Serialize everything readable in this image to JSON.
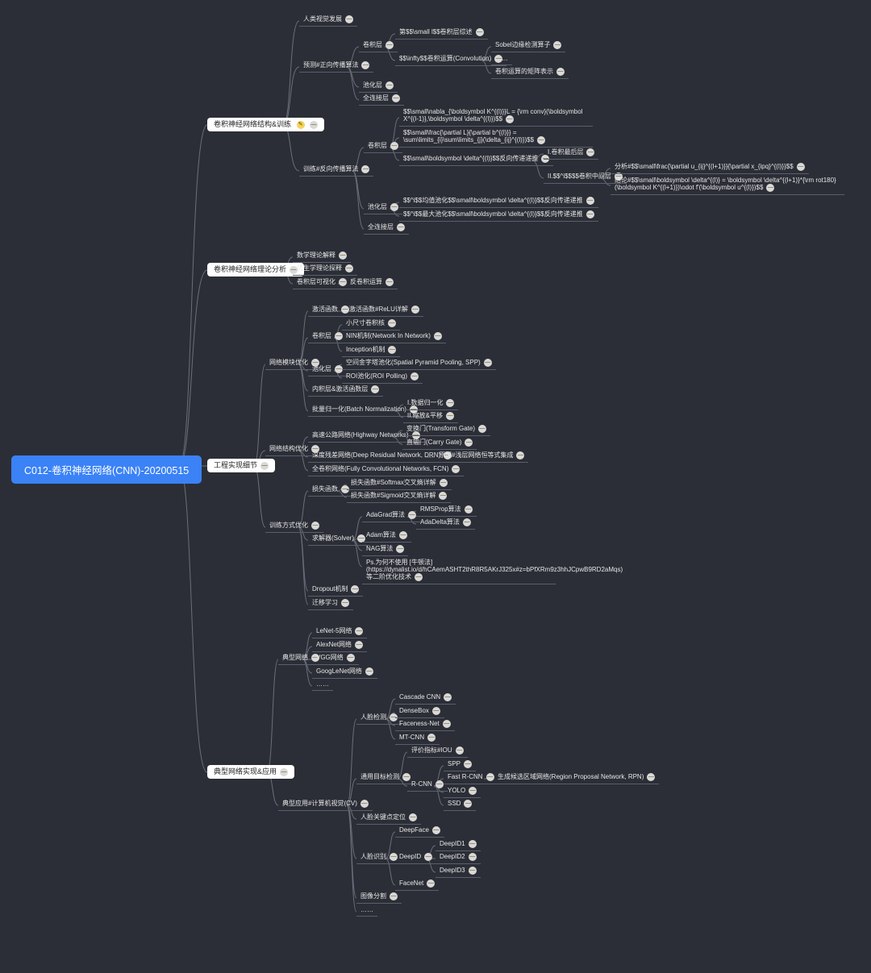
{
  "root": "C012-卷积神经网络(CNN)-20200515",
  "b1": "卷积神经网络结构&训练",
  "b1_a": "人类视觉发展",
  "b1_b": "预测#正向传播算法",
  "b1_b1": "卷积层",
  "b1_b1a": "第$$\\small l$$卷积层综述",
  "b1_b1b": "$$\\infty$$卷积运算(Convolution)",
  "b1_b1b1": "Sobel边缘检测算子",
  "b1_b1b2": "……",
  "b1_b1b3": "卷积运算的矩阵表示",
  "b1_b2": "池化层",
  "b1_b3": "全连接层",
  "b1_c": "训练#反向传播算法",
  "b1_c1": "卷积层",
  "b1_c1a": "$$\\small\\nabla_{\\boldsymbol K^{(l)}}L = {\\rm conv}(\\boldsymbol X^{(l-1)},\\boldsymbol \\delta^{(l)})$$",
  "b1_c1b": "$$\\small\\frac{\\partial L}{\\partial b^{(l)}} = \\sum\\limits_{i}\\sum\\limits_{j}(\\delta_{ij}^{(l)})$$",
  "b1_c1c": "$$\\small\\boldsymbol \\delta^{(l)}$$反向传递递推",
  "b1_c1c1": "I.卷积最后层",
  "b1_c1c2": "II.$$^i$$$$卷积中间层",
  "b1_c1c2a": "分析#$$\\small\\frac{\\partial u_{ij}^{(l+1)}}{\\partial x_{ipq}^{(l)}}$$",
  "b1_c1c2b": "结论#$$\\small\\boldsymbol \\delta^{(l)} = \\boldsymbol \\delta^{(l+1)}*{\\rm rot180}(\\boldsymbol K^{(l+1)})\\odot f'(\\boldsymbol u^{(l)})$$",
  "b1_c2": "池化层",
  "b1_c2a": "$$^i$$均值池化$$\\small\\boldsymbol \\delta^{(l)}$$反向传递递推",
  "b1_c2b": "$$^i$$最大池化$$\\small\\boldsymbol \\delta^{(l)}$$反向传递递推",
  "b1_c3": "全连接层",
  "b2": "卷积神经网络理论分析",
  "b2_a": "数学理论解释",
  "b2_b": "仿生学理论探释",
  "b2_c": "卷积层可视化",
  "b2_c1": "反卷积运算",
  "b3": "工程实现细节",
  "b3_a": "网络模块优化",
  "b3_a1": "激活函数",
  "b3_a1a": "激活函数#ReLU详解",
  "b3_a2": "卷积层",
  "b3_a2a": "小尺寸卷积核",
  "b3_a2b": "NIN机制(Network In Network)",
  "b3_a2c": "Inception机制",
  "b3_a3": "池化层",
  "b3_a3a": "空间金字塔池化(Spatial Pyramid Pooling, SPP)",
  "b3_a3b": "ROI池化(ROI Polling)",
  "b3_a4": "内积层&激活函数层",
  "b3_a5": "批量归一化(Batch Normalization)",
  "b3_a5a": "I.数据归一化",
  "b3_a5b": "II.缩放&平移",
  "b3_b": "网络结构优化",
  "b3_b1": "高速公路网络(Highway Networks)",
  "b3_b1a": "变换门(Transform Gate)",
  "b3_b1b": "直输门(Carry Gate)",
  "b3_b2": "深度残差网络(Deep Residual Network, DRN)",
  "b3_b2a": "原理#浅层网络恒等式集成",
  "b3_b3": "全卷积网络(Fully Convolutional Networks, FCN)",
  "b3_c": "训练方式优化",
  "b3_c_loss": "损失函数",
  "b3_c_loss1": "损失函数#Softmax交叉熵详解",
  "b3_c_loss2": "损失函数#Sigmoid交叉熵详解",
  "b3_c_solver": "求解器(Solver)",
  "b3_c_s1": "AdaGrad算法",
  "b3_c_s1a": "RMSProp算法",
  "b3_c_s1b": "AdaDelta算法",
  "b3_c_s2": "Adam算法",
  "b3_c_s3": "NAG算法",
  "b3_c_s4": "Ps.为何不使用 [牛顿法](https://dynalist.io/d/hCAemASHT2thR8R5AKrJ325x#z=bPfXRm9z3hhJCpwB9RD2aMqs) 等二阶优化技术",
  "b3_c_drop": "Dropout机制",
  "b3_c_tran": "迁移学习",
  "b4": "典型网络实现&应用",
  "b4_a": "典型网络",
  "b4_a1": "LeNet-5网络",
  "b4_a2": "AlexNet网络",
  "b4_a3": "VGG网络",
  "b4_a4": "GoogLeNet网络",
  "b4_a5": "……",
  "b4_b": "典型应用#计算机视觉(CV)",
  "b4_b1": "人脸检测",
  "b4_b1a": "Cascade CNN",
  "b4_b1b": "DenseBox",
  "b4_b1c": "Faceness-Net",
  "b4_b1d": "MT-CNN",
  "b4_b2": "通用目标检测",
  "b4_b2a": "评价指标#IOU",
  "b4_b2b": "R-CNN",
  "b4_b2b1": "SPP",
  "b4_b2b2": "Fast R-CNN",
  "b4_b2b2a": "生成候选区域网络(Region Proposal Network, RPN)",
  "b4_b2b3": "YOLO",
  "b4_b2b4": "SSD",
  "b4_b3": "人脸关键点定位",
  "b4_b4": "人脸识别",
  "b4_b4a": "DeepFace",
  "b4_b4b": "DeepID",
  "b4_b4b1": "DeepID1",
  "b4_b4b2": "DeepID2",
  "b4_b4b3": "DeepID3",
  "b4_b4c": "FaceNet",
  "b4_b5": "图像分割",
  "b4_b6": "……"
}
